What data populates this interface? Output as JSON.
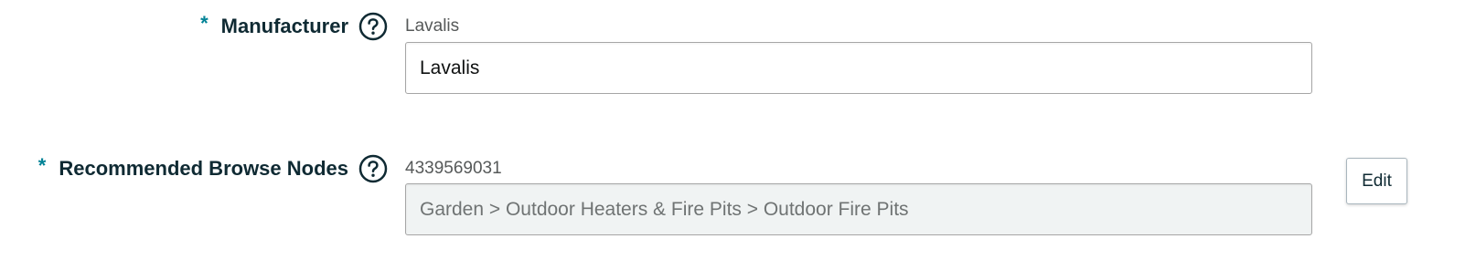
{
  "manufacturer": {
    "required_mark": "*",
    "label": "Manufacturer",
    "help_icon": "question-circle-icon",
    "hint": "Lavalis",
    "value": "Lavalis"
  },
  "browse_nodes": {
    "required_mark": "*",
    "label": "Recommended Browse Nodes",
    "help_icon": "question-circle-icon",
    "hint": "4339569031",
    "value": "Garden > Outdoor Heaters & Fire Pits > Outdoor Fire Pits",
    "edit_label": "Edit"
  },
  "colors": {
    "required_mark": "#008296",
    "label": "#0f2a33",
    "readonly_bg": "#f0f3f3"
  }
}
